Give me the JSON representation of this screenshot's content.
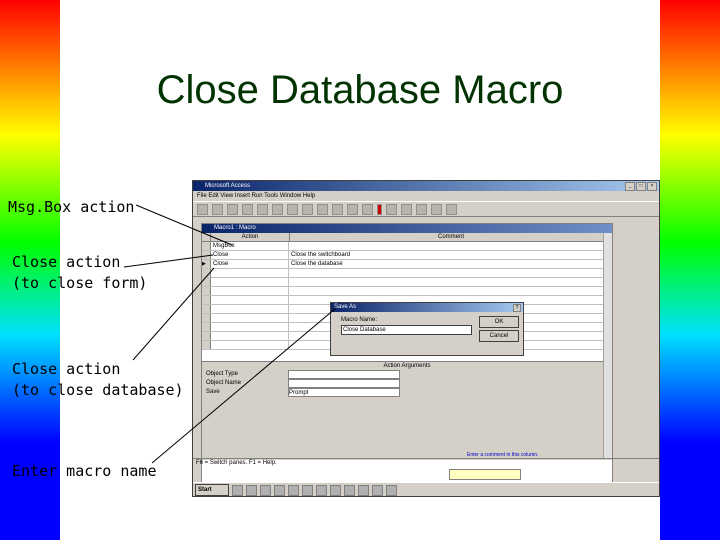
{
  "slide": {
    "title": "Close Database Macro",
    "callouts": [
      "Msg.Box action",
      "Close action\n(to close form)",
      "Close action\n(to close database)",
      "Enter macro name"
    ],
    "gradient_colors": [
      "#ff0000",
      "#ffff00",
      "#00ff00",
      "#00e0ff",
      "#0000ff"
    ]
  },
  "screenshot": {
    "app_title": "Microsoft Access",
    "menu": "File  Edit  View  Insert  Run  Tools  Window  Help",
    "macro_window": {
      "title": "Macro1 : Macro",
      "columns": [
        "Action",
        "Comment"
      ],
      "rows": [
        {
          "action": "MsgBox",
          "comment": ""
        },
        {
          "action": "Close",
          "comment": "Close the switchboard"
        },
        {
          "action": "Close",
          "comment": "Close the database"
        }
      ],
      "arguments_header": "Action Arguments",
      "arguments": [
        {
          "label": "Object Type",
          "value": ""
        },
        {
          "label": "Object Name",
          "value": ""
        },
        {
          "label": "Save",
          "value": "Prompt"
        }
      ],
      "hint": "Enter a comment in this column."
    },
    "save_as_dialog": {
      "title": "Save As",
      "label": "Macro Name:",
      "value": "Close Database",
      "ok": "OK",
      "cancel": "Cancel"
    },
    "status": "F6 = Switch panes.  F1 = Help.",
    "taskbar": {
      "start": "Start"
    }
  }
}
